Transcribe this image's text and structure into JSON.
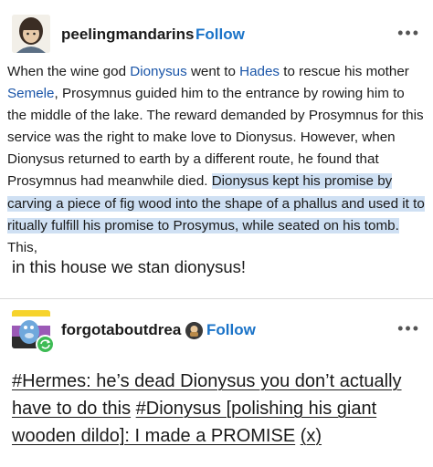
{
  "post1": {
    "username": "peelingmandarins",
    "follow_label": "Follow",
    "more_label": "•••",
    "quote_parts": [
      "When the wine god ",
      "Dionysus",
      " went to ",
      "Hades",
      " to rescue his mother ",
      "Semele",
      ", Prosymnus guided him to the entrance by rowing him to the middle of the lake. The reward demanded by Prosymnus for this service was the right to make love to Dionysus. However, when Dionysus returned to earth by a different route, he found that Prosymnus had meanwhile died. ",
      "Dionysus kept his promise by carving a piece of fig wood into the shape of a phallus and used it to ritually fulfill his promise to Prosymus, while seated on his tomb.",
      " This,"
    ],
    "reply": "in this house we stan dionysus!"
  },
  "post2": {
    "username": "forgotaboutdrea",
    "follow_label": "Follow",
    "more_label": "•••",
    "body_parts": [
      "#Hermes: he’s dead Dionysus you don’t actually have to do this",
      " ",
      "#Dionysus [polishing his giant wooden dildo]: I made a PROMISE",
      " ",
      "(x)"
    ]
  },
  "colors": {
    "follow": "#1a73c8",
    "link": "#1a55a8",
    "highlight": "#cfe0f3"
  },
  "icons": [
    "avatar-peelingmandarins",
    "avatar-forgotaboutdrea",
    "badge-icon",
    "more-options-icon",
    "reblog-icon"
  ]
}
